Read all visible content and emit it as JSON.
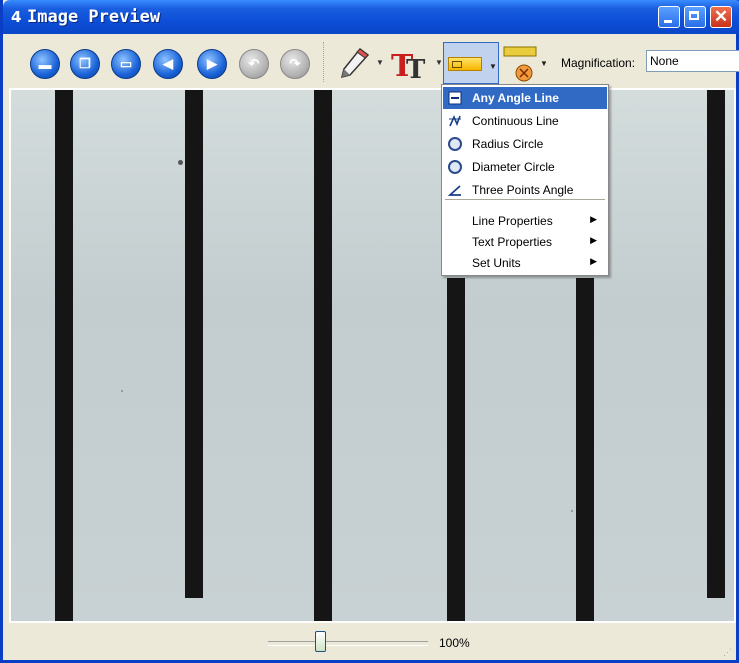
{
  "window": {
    "title": "Image Preview",
    "close_glyph": "✕"
  },
  "toolbar": {
    "buttons": [
      {
        "name": "save",
        "icon": "save-icon"
      },
      {
        "name": "copy",
        "icon": "copy-icon"
      },
      {
        "name": "print",
        "icon": "print-icon"
      },
      {
        "name": "previous",
        "icon": "arrow-left-icon"
      },
      {
        "name": "next",
        "icon": "arrow-right-icon"
      },
      {
        "name": "undo",
        "icon": "undo-icon"
      },
      {
        "name": "redo",
        "icon": "redo-icon"
      }
    ],
    "magnification_label": "Magnification:",
    "magnification_value": "None"
  },
  "measure_menu": {
    "items": [
      {
        "label": "Any Angle Line",
        "icon": "line-icon",
        "selected": true
      },
      {
        "label": "Continuous Line",
        "icon": "polyline-icon"
      },
      {
        "label": "Radius Circle",
        "icon": "radius-circle-icon"
      },
      {
        "label": "Diameter Circle",
        "icon": "diameter-circle-icon"
      },
      {
        "label": "Three Points Angle",
        "icon": "angle-icon"
      }
    ],
    "submenus": [
      {
        "label": "Line Properties"
      },
      {
        "label": "Text Properties"
      },
      {
        "label": "Set Units"
      }
    ],
    "submenu_arrow": "▶"
  },
  "status": {
    "zoom": "100%"
  },
  "colors": {
    "titlebar": "#0a46c8",
    "selection": "#316ac5",
    "canvas": "#c6d0d2"
  }
}
